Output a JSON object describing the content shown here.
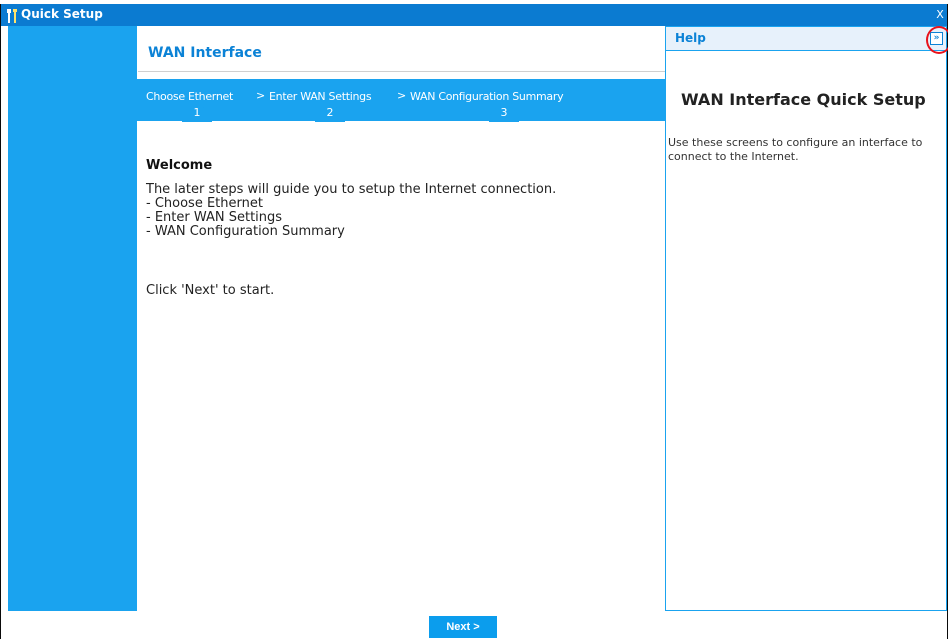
{
  "window": {
    "title": "Quick Setup",
    "close_symbol": "X"
  },
  "main": {
    "title": "WAN Interface",
    "steps": [
      {
        "label": "Choose Ethernet",
        "number": "1"
      },
      {
        "label": "Enter WAN Settings",
        "number": "2"
      },
      {
        "label": "WAN Configuration Summary",
        "number": "3"
      }
    ],
    "step_separator": ">",
    "welcome_heading": "Welcome",
    "intro": "The later steps will guide you to setup the Internet connection.",
    "bullet_items": [
      "- Choose Ethernet",
      "- Enter WAN Settings",
      "- WAN Configuration Summary"
    ],
    "start_hint": "Click 'Next' to start."
  },
  "help": {
    "label": "Help",
    "collapse_symbol": "»",
    "heading": "WAN Interface Quick Setup",
    "body": "Use these screens to configure an interface to connect to the Internet."
  },
  "footer": {
    "next_label": "Next >"
  },
  "colors": {
    "titlebar": "#0b7bd1",
    "accent": "#1aa3ef",
    "highlight_ring": "#e8121b"
  },
  "icons": {
    "app_logo": "tools-icon",
    "close": "close-icon",
    "collapse": "double-chevron-right-icon"
  }
}
